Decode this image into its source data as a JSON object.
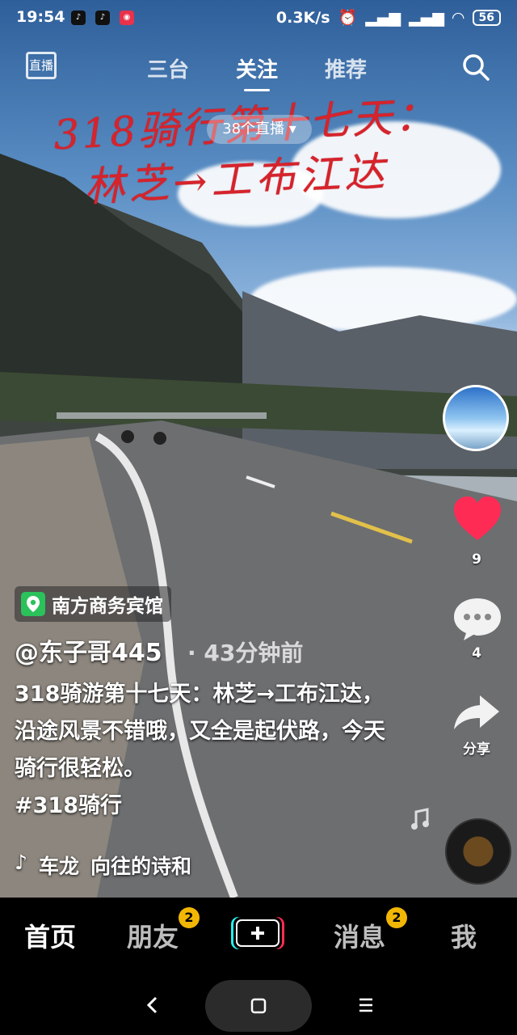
{
  "status": {
    "time": "19:54",
    "app_icons": [
      "tiktok-icon",
      "tiktok-icon",
      "weibo-icon"
    ],
    "net_speed": "0.3K/s",
    "battery": "56"
  },
  "topnav": {
    "live_icon_label": "直播",
    "tabs": [
      {
        "label": "三台",
        "active": false
      },
      {
        "label": "关注",
        "active": true
      },
      {
        "label": "推荐",
        "active": false
      }
    ],
    "live_pill": "38个直播"
  },
  "video_overlay": {
    "line1": "318骑行第十七天：",
    "line2": "林芝→工布江达"
  },
  "rail": {
    "like_count": "9",
    "comment_count": "4",
    "share_label": "分享"
  },
  "post": {
    "location": "南方商务宾馆",
    "author": "@东子哥445",
    "separator": "·",
    "time_ago": "43分钟前",
    "caption": "318骑游第十七天：林芝→工布江达，沿途风景不错哦，又全是起伏路，今天骑行很轻松。",
    "hashtag": "#318骑行",
    "music_left": "车龙",
    "music_right": "向往的诗和"
  },
  "bottombar": {
    "tabs": [
      {
        "label": "首页",
        "active": true,
        "badge": ""
      },
      {
        "label": "朋友",
        "active": false,
        "badge": "2"
      },
      {
        "label": "消息",
        "active": false,
        "badge": "2"
      },
      {
        "label": "我",
        "active": false,
        "badge": ""
      }
    ]
  },
  "colors": {
    "accent_red": "#fe2c55",
    "badge_yellow": "#f2b705",
    "location_green": "#2bc15b"
  }
}
